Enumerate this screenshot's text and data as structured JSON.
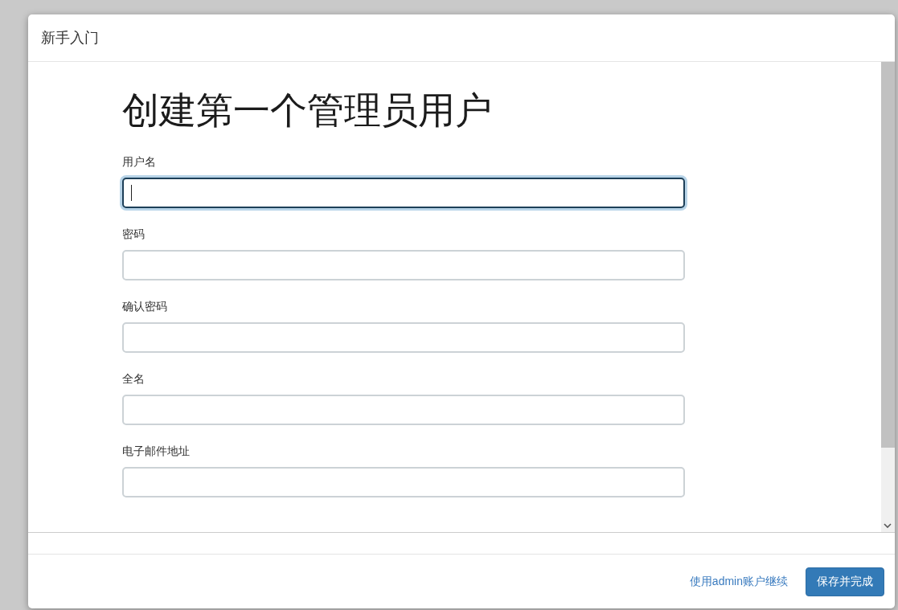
{
  "dialog": {
    "title": "新手入门"
  },
  "form": {
    "heading": "创建第一个管理员用户",
    "fields": [
      {
        "label": "用户名",
        "focused": true
      },
      {
        "label": "密码",
        "focused": false
      },
      {
        "label": "确认密码",
        "focused": false
      },
      {
        "label": "全名",
        "focused": false
      },
      {
        "label": "电子邮件地址",
        "focused": false
      }
    ]
  },
  "footer": {
    "link": "使用admin账户继续",
    "button": "保存并完成"
  }
}
